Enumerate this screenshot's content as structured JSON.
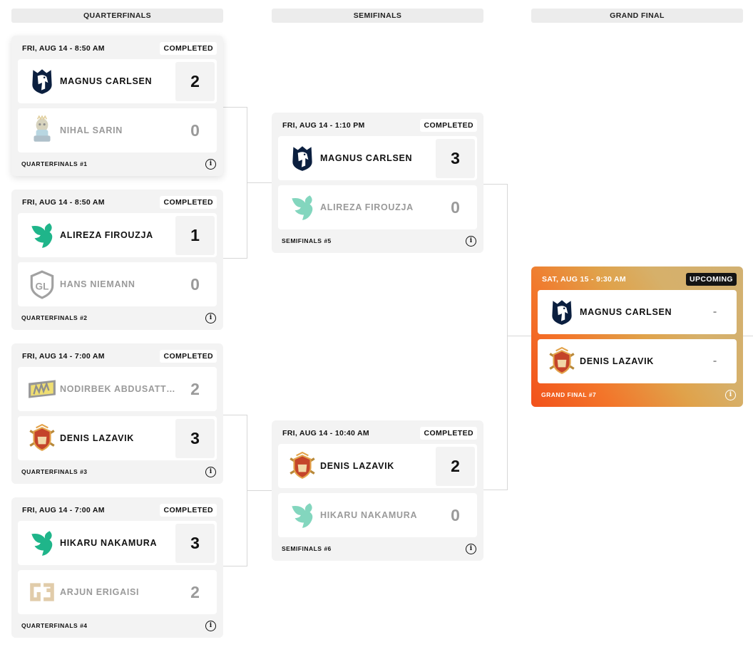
{
  "rounds": {
    "quarterfinals": "QUARTERFINALS",
    "semifinals": "SEMIFINALS",
    "grand_final": "GRAND FINAL"
  },
  "matches": {
    "qf1": {
      "date": "FRI, AUG 14 - 8:50 AM",
      "status": "COMPLETED",
      "label": "QUARTERFINALS #1",
      "team1": {
        "name": "MAGNUS CARLSEN",
        "score": "2",
        "logo": "liquid-horse-logo"
      },
      "team2": {
        "name": "NIHAL SARIN",
        "score": "0",
        "logo": "mascot-logo"
      }
    },
    "qf2": {
      "date": "FRI, AUG 14 - 8:50 AM",
      "status": "COMPLETED",
      "label": "QUARTERFINALS #2",
      "team1": {
        "name": "ALIREZA FIROUZJA",
        "score": "1",
        "logo": "falcon-logo"
      },
      "team2": {
        "name": "HANS NIEMANN",
        "score": "0",
        "logo": "gl-shield-logo"
      }
    },
    "qf3": {
      "date": "FRI, AUG 14 - 7:00 AM",
      "status": "COMPLETED",
      "label": "QUARTERFINALS #3",
      "team1": {
        "name": "NODIRBEK ABDUSATTOROV",
        "score": "2",
        "logo": "navi-logo"
      },
      "team2": {
        "name": "DENIS LAZAVIK",
        "score": "3",
        "logo": "crest-logo"
      }
    },
    "qf4": {
      "date": "FRI, AUG 14 - 7:00 AM",
      "status": "COMPLETED",
      "label": "QUARTERFINALS #4",
      "team1": {
        "name": "HIKARU NAKAMURA",
        "score": "3",
        "logo": "falcon-logo"
      },
      "team2": {
        "name": "ARJUN ERIGAISI",
        "score": "2",
        "logo": "geng-logo"
      }
    },
    "sf5": {
      "date": "FRI, AUG 14 - 1:10 PM",
      "status": "COMPLETED",
      "label": "SEMIFINALS #5",
      "team1": {
        "name": "MAGNUS CARLSEN",
        "score": "3",
        "logo": "liquid-horse-logo"
      },
      "team2": {
        "name": "ALIREZA FIROUZJA",
        "score": "0",
        "logo": "falcon-logo"
      }
    },
    "sf6": {
      "date": "FRI, AUG 14 - 10:40 AM",
      "status": "COMPLETED",
      "label": "SEMIFINALS #6",
      "team1": {
        "name": "DENIS LAZAVIK",
        "score": "2",
        "logo": "crest-logo"
      },
      "team2": {
        "name": "HIKARU NAKAMURA",
        "score": "0",
        "logo": "falcon-logo"
      }
    },
    "gf7": {
      "date": "SAT, AUG 15 - 9:30 AM",
      "status": "UPCOMING",
      "label": "GRAND FINAL #7",
      "team1": {
        "name": "MAGNUS CARLSEN",
        "score": "-",
        "logo": "liquid-horse-logo"
      },
      "team2": {
        "name": "DENIS LAZAVIK",
        "score": "-",
        "logo": "crest-logo"
      }
    }
  },
  "colors": {
    "liquid": "#0b1f3f",
    "falcon": "#1fb58a",
    "navi": "#e3c400",
    "crest": "#c4442a",
    "final_gradient_start": "#f2511b",
    "final_gradient_end": "#d2b172"
  }
}
